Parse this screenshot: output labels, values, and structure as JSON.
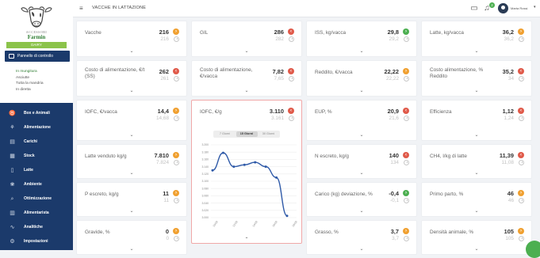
{
  "colors": {
    "sidebar": "#1b3a6b",
    "badge_orange": "#f0a030",
    "badge_red": "#e05a4a",
    "badge_green": "#4caf50",
    "chart_line": "#2f5aa8"
  },
  "brand": {
    "line1": "ACCESSORI",
    "line2": "Farmin"
  },
  "sidebar": {
    "dairy_badge": "DAIRY",
    "active_item": {
      "label": "Pannello di controllo",
      "icon": "monitor-icon"
    },
    "sub_items": [
      "In mungitura",
      "Asciutte",
      "Tutta la mandria",
      "In diretta"
    ],
    "items": [
      {
        "label": "Box e Animali",
        "icon": "cow-icon"
      },
      {
        "label": "Alimentazione",
        "icon": "feed-icon"
      },
      {
        "label": "Carichi",
        "icon": "truck-icon"
      },
      {
        "label": "Stock",
        "icon": "stock-icon"
      },
      {
        "label": "Latte",
        "icon": "milk-icon"
      },
      {
        "label": "Ambiente",
        "icon": "leaf-icon"
      },
      {
        "label": "Ottimizzazione",
        "icon": "search-icon"
      },
      {
        "label": "Alimentarista",
        "icon": "book-icon"
      },
      {
        "label": "Analitiche",
        "icon": "chart-icon"
      },
      {
        "label": "Impostazioni",
        "icon": "gear-icon"
      }
    ]
  },
  "topbar": {
    "menu_icon": "≡",
    "title": "VACCHE IN LATTAZIONE",
    "notification_count": "2",
    "user_name": "Marta Rossi"
  },
  "cards": [
    {
      "label": "Vacche",
      "value": "216",
      "prev": "216",
      "status": "orange"
    },
    {
      "label": "GIL",
      "value": "286",
      "prev": "282",
      "status": "red"
    },
    {
      "label": "ISS, kg/vacca",
      "value": "29,8",
      "prev": "29,2",
      "status": "green"
    },
    {
      "label": "Latte, kg/vacca",
      "value": "36,2",
      "prev": "36,2",
      "status": "orange"
    },
    {
      "label": "Costo di alimentazione, €/t (SS)",
      "value": "262",
      "prev": "261",
      "status": "red"
    },
    {
      "label": "Costo di alimentazione, €/vacca",
      "value": "7,82",
      "prev": "7,65",
      "status": "red"
    },
    {
      "label": "Reddito, €/vacca",
      "value": "22,22",
      "prev": "22,22",
      "status": "orange"
    },
    {
      "label": "Costo alimentazione, % Reddito",
      "value": "35,2",
      "prev": "34",
      "status": "red"
    },
    {
      "label": "IOFC, €/vacca",
      "value": "14,4",
      "prev": "14,68",
      "status": "orange"
    },
    {
      "label": "IOFC, €/g",
      "value": "3.110",
      "prev": "3.161",
      "status": "red"
    },
    {
      "label": "EUP, %",
      "value": "20,9",
      "prev": "21,6",
      "status": "red"
    },
    {
      "label": "Efficienza",
      "value": "1,12",
      "prev": "1,24",
      "status": "red"
    },
    {
      "label": "Latte venduto kg/g",
      "value": "7.810",
      "prev": "7.824",
      "status": "orange"
    },
    {
      "label": "N escreto, kg/g",
      "value": "140",
      "prev": "134",
      "status": "red"
    },
    {
      "label": "CH4, l/kg di latte",
      "value": "11,39",
      "prev": "11,08",
      "status": "red"
    },
    {
      "label": "P escreto, kg/g",
      "value": "11",
      "prev": "11",
      "status": "orange"
    },
    {
      "label": "Carico (kg) deviazione, %",
      "value": "-0,4",
      "prev": "-0,1",
      "status": "green"
    },
    {
      "label": "Primo parto, %",
      "value": "46",
      "prev": "46",
      "status": "orange"
    },
    {
      "label": "Gravide, %",
      "value": "0",
      "prev": "0",
      "status": "orange"
    },
    {
      "label": "Grasso, %",
      "value": "3,7",
      "prev": "3,7",
      "status": "orange"
    },
    {
      "label": "Densità animale, %",
      "value": "105",
      "prev": "105",
      "status": "orange"
    }
  ],
  "period_tabs": [
    "7 Giorni",
    "15 Giorni",
    "30 Giorni"
  ],
  "active_period": 1,
  "chart_data": {
    "type": "line",
    "y_ticks": [
      "3.200",
      "3.180",
      "3.160",
      "3.140",
      "3.120",
      "3.100",
      "3.080",
      "3.060",
      "3.040",
      "3.020",
      "3.000"
    ],
    "ylim": [
      3000,
      3200
    ],
    "x_ticks": [
      "10/08",
      "12/08",
      "14/08",
      "16/08",
      "18/08"
    ],
    "series": [
      {
        "values": [
          3130,
          3178,
          3140,
          3145,
          3152,
          3140,
          3110,
          3005
        ]
      }
    ]
  }
}
